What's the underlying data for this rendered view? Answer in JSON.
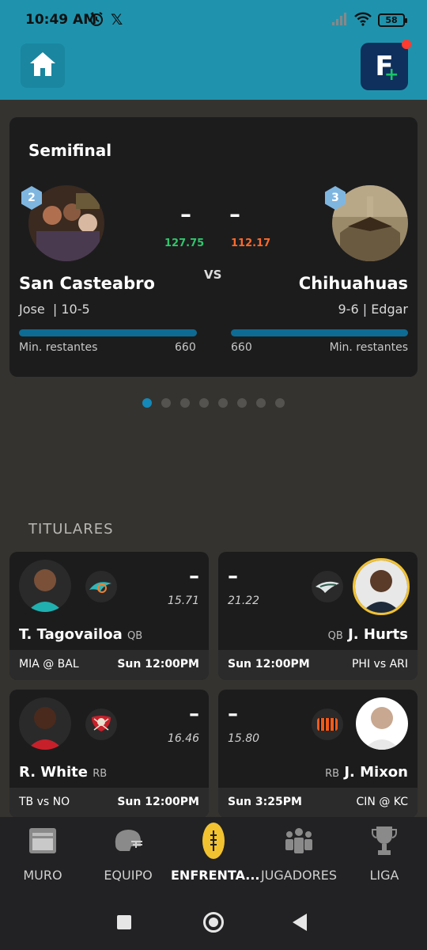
{
  "status_bar": {
    "time": "10:49 AM",
    "battery": "58"
  },
  "app_bar": {
    "home_icon": "home-icon",
    "fantasy_icon": "fantasy-plus-icon"
  },
  "matchup": {
    "round": "Semifinal",
    "vs": "VS",
    "min_label": "Min. restantes",
    "home": {
      "seed": "2",
      "name": "San Casteabro",
      "owner_record": "Jose  | 10-5",
      "score": "–",
      "projected": "127.75",
      "minutes": "660",
      "projected_color": "#2fc76a"
    },
    "away": {
      "seed": "3",
      "name": "Chihuahuas",
      "owner_record": "9-6 | Edgar",
      "score": "–",
      "projected": "112.17",
      "minutes": "660",
      "projected_color": "#ff6a2a"
    }
  },
  "pager": {
    "count": 8,
    "active": 0
  },
  "starters": {
    "title": "TITULARES",
    "players": [
      {
        "name": "T. Tagovailoa",
        "pos": "QB",
        "score": "–",
        "projected": "15.71",
        "game": "MIA @ BAL",
        "time": "Sun 12:00PM",
        "team_logo": "dolphins-logo"
      },
      {
        "name": "J. Hurts",
        "pos": "QB",
        "score": "–",
        "projected": "21.22",
        "game": "PHI vs ARI",
        "time": "Sun 12:00PM",
        "team_logo": "eagles-logo"
      },
      {
        "name": "R. White",
        "pos": "RB",
        "score": "–",
        "projected": "16.46",
        "game": "TB vs NO",
        "time": "Sun 12:00PM",
        "team_logo": "buccaneers-logo"
      },
      {
        "name": "J. Mixon",
        "pos": "RB",
        "score": "–",
        "projected": "15.80",
        "game": "CIN @ KC",
        "time": "Sun 3:25PM",
        "team_logo": "bengals-logo"
      }
    ]
  },
  "bottom_nav": [
    {
      "label": "MURO",
      "icon": "feed-icon",
      "active": false
    },
    {
      "label": "EQUIPO",
      "icon": "helmet-icon",
      "active": false
    },
    {
      "label": "ENFRENTA...",
      "icon": "football-icon",
      "active": true
    },
    {
      "label": "JUGADORES",
      "icon": "players-icon",
      "active": false
    },
    {
      "label": "LIGA",
      "icon": "trophy-icon",
      "active": false
    }
  ],
  "colors": {
    "header": "#1f93ad",
    "background": "#35332f",
    "card": "#1c1c1d",
    "accent_bar": "#0e6b93",
    "hurts_ring": "#f2c230"
  }
}
